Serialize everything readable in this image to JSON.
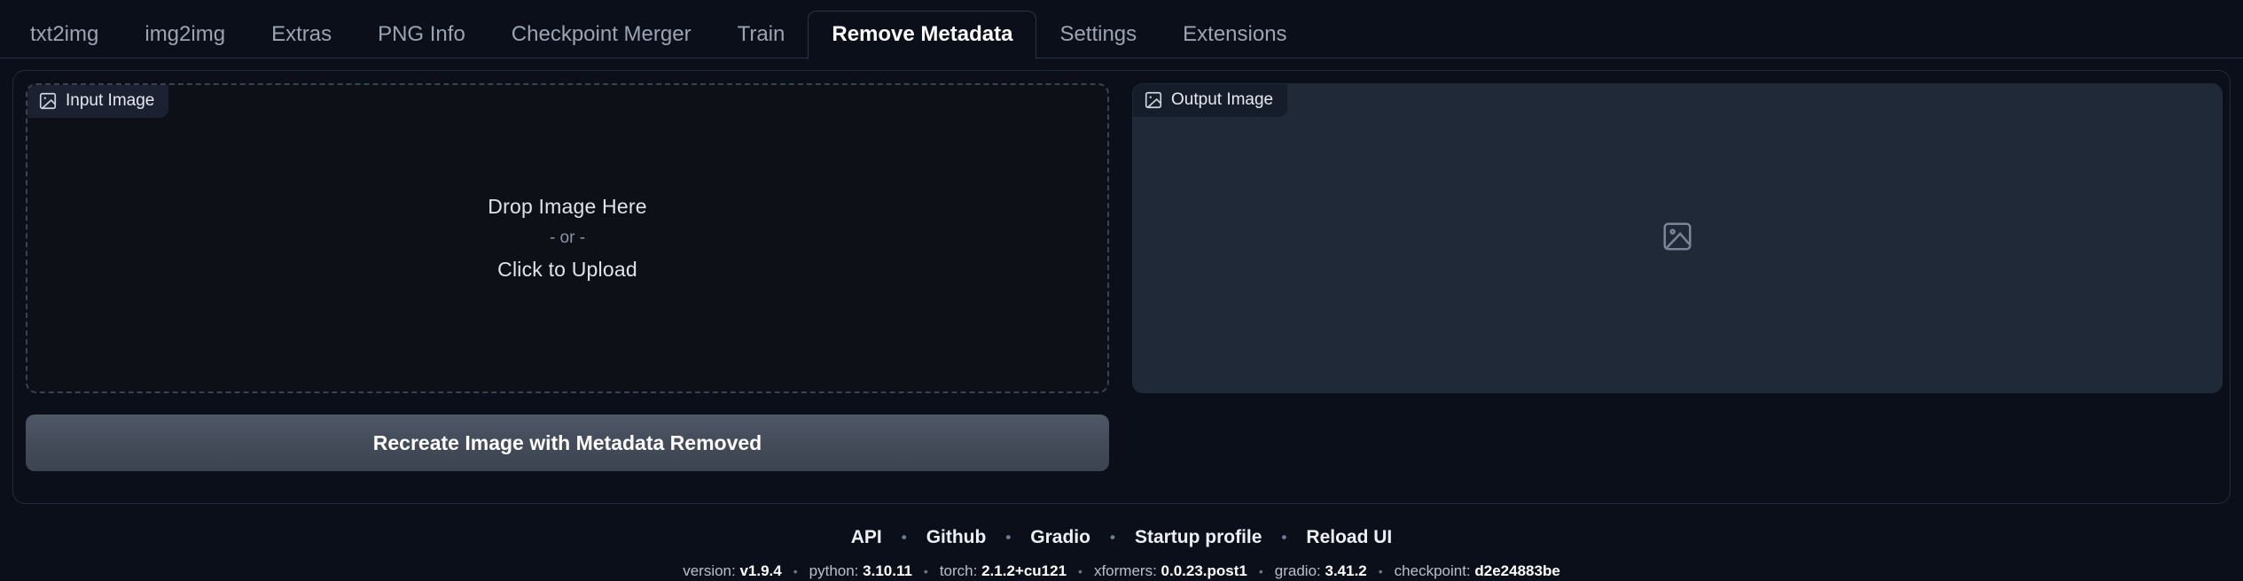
{
  "tabs": [
    {
      "label": "txt2img",
      "active": false
    },
    {
      "label": "img2img",
      "active": false
    },
    {
      "label": "Extras",
      "active": false
    },
    {
      "label": "PNG Info",
      "active": false
    },
    {
      "label": "Checkpoint Merger",
      "active": false
    },
    {
      "label": "Train",
      "active": false
    },
    {
      "label": "Remove Metadata",
      "active": true
    },
    {
      "label": "Settings",
      "active": false
    },
    {
      "label": "Extensions",
      "active": false
    }
  ],
  "input_panel": {
    "label": "Input Image",
    "icon": "image-icon",
    "drop_primary": "Drop Image Here",
    "drop_or": "- or -",
    "drop_secondary": "Click to Upload"
  },
  "output_panel": {
    "label": "Output Image",
    "icon": "image-icon",
    "placeholder_icon": "image-placeholder-icon"
  },
  "action": {
    "label": "Recreate Image with Metadata Removed"
  },
  "footer": {
    "links": [
      {
        "label": "API"
      },
      {
        "label": "Github"
      },
      {
        "label": "Gradio"
      },
      {
        "label": "Startup profile"
      },
      {
        "label": "Reload UI"
      }
    ],
    "separator": "•",
    "versions": [
      {
        "key": "version:",
        "value": "v1.9.4"
      },
      {
        "key": "python:",
        "value": "3.10.11"
      },
      {
        "key": "torch:",
        "value": "2.1.2+cu121"
      },
      {
        "key": "xformers:",
        "value": "0.0.23.post1"
      },
      {
        "key": "gradio:",
        "value": "3.41.2"
      },
      {
        "key": "checkpoint:",
        "value": "d2e24883be"
      }
    ]
  },
  "colors": {
    "page_bg": "#0b0f19",
    "panel_border": "#232b3b",
    "output_bg": "#1f2937",
    "input_bg": "#0d1117",
    "button_top": "#4e5766",
    "button_bottom": "#3c4350",
    "tab_inactive_text": "#9aa4b4",
    "tab_active_text": "#ffffff"
  }
}
